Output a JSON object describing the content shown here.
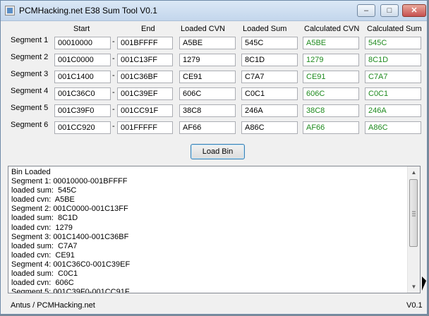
{
  "window": {
    "title": "PCMHacking.net E38 Sum Tool V0.1",
    "controls": {
      "minimize": "–",
      "maximize": "□",
      "close": "✕"
    }
  },
  "columns": {
    "start": "Start",
    "end": "End",
    "loaded_cvn": "Loaded CVN",
    "loaded_sum": "Loaded Sum",
    "calc_cvn": "Calculated CVN",
    "calc_sum": "Calculated Sum"
  },
  "segments": [
    {
      "label": "Segment 1",
      "start": "00010000",
      "end": "001BFFFF",
      "loaded_cvn": "A5BE",
      "loaded_sum": "545C",
      "calc_cvn": "A5BE",
      "calc_sum": "545C"
    },
    {
      "label": "Segment 2",
      "start": "001C0000",
      "end": "001C13FF",
      "loaded_cvn": "1279",
      "loaded_sum": "8C1D",
      "calc_cvn": "1279",
      "calc_sum": "8C1D"
    },
    {
      "label": "Segment 3",
      "start": "001C1400",
      "end": "001C36BF",
      "loaded_cvn": "CE91",
      "loaded_sum": "C7A7",
      "calc_cvn": "CE91",
      "calc_sum": "C7A7"
    },
    {
      "label": "Segment 4",
      "start": "001C36C0",
      "end": "001C39EF",
      "loaded_cvn": "606C",
      "loaded_sum": "C0C1",
      "calc_cvn": "606C",
      "calc_sum": "C0C1"
    },
    {
      "label": "Segment 5",
      "start": "001C39F0",
      "end": "001CC91F",
      "loaded_cvn": "38C8",
      "loaded_sum": "246A",
      "calc_cvn": "38C8",
      "calc_sum": "246A"
    },
    {
      "label": "Segment 6",
      "start": "001CC920",
      "end": "001FFFFF",
      "loaded_cvn": "AF66",
      "loaded_sum": "A86C",
      "calc_cvn": "AF66",
      "calc_sum": "A86C"
    }
  ],
  "separator": "-",
  "load_button": "Load Bin",
  "log_text": "Bin Loaded\nSegment 1: 00010000-001BFFFF\nloaded sum:  545C\nloaded cvn:  A5BE\nSegment 2: 001C0000-001C13FF\nloaded sum:  8C1D\nloaded cvn:  1279\nSegment 3: 001C1400-001C36BF\nloaded sum:  C7A7\nloaded cvn:  CE91\nSegment 4: 001C36C0-001C39EF\nloaded sum:  C0C1\nloaded cvn:  606C\nSegment 5: 001C39F0-001CC91F",
  "status": {
    "left": "Antus / PCMHacking.net",
    "right": "V0.1"
  },
  "colors": {
    "calculated_text": "#1e8a1e"
  }
}
